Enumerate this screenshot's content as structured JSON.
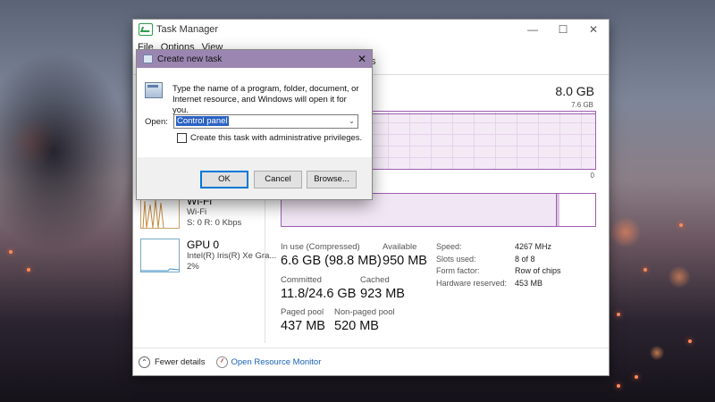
{
  "task_manager": {
    "title": "Task Manager",
    "menu": [
      "File",
      "Options",
      "View"
    ],
    "tab_fragment": "s",
    "sidebar": {
      "wifi": {
        "label": "Wi-Fi",
        "sub1": "Wi-Fi",
        "sub2": "S: 0 R: 0 Kbps"
      },
      "gpu": {
        "label": "GPU 0",
        "sub1": "Intel(R) Iris(R) Xe Gra...",
        "sub2": "2%"
      }
    },
    "memory": {
      "total": "8.0 GB",
      "graph_max": "7.6 GB",
      "graph_min": "0",
      "in_use_label": "In use (Compressed)",
      "in_use_value": "6.6 GB (98.8 MB)",
      "available_label": "Available",
      "available_value": "950 MB",
      "committed_label": "Committed",
      "committed_value": "11.8/24.6 GB",
      "cached_label": "Cached",
      "cached_value": "923 MB",
      "paged_label": "Paged pool",
      "paged_value": "437 MB",
      "nonpaged_label": "Non-paged pool",
      "nonpaged_value": "520 MB",
      "hardware": [
        {
          "k": "Speed:",
          "v": "4267 MHz"
        },
        {
          "k": "Slots used:",
          "v": "8 of 8"
        },
        {
          "k": "Form factor:",
          "v": "Row of chips"
        },
        {
          "k": "Hardware reserved:",
          "v": "453 MB"
        }
      ]
    },
    "footer": {
      "fewer_details": "Fewer details",
      "open_resource_monitor": "Open Resource Monitor"
    }
  },
  "dialog": {
    "title": "Create new task",
    "instructions": "Type the name of a program, folder, document, or Internet resource, and Windows will open it for you.",
    "open_label": "Open:",
    "open_value": "Control panel",
    "admin_label": "Create this task with administrative privileges.",
    "ok": "OK",
    "cancel": "Cancel",
    "browse": "Browse..."
  },
  "icons": {
    "task_manager": "task-manager-icon",
    "run": "run-icon",
    "dropdown": "chevron-down-icon",
    "fewer_details": "chevron-up-icon",
    "resource_monitor": "resource-monitor-icon"
  }
}
